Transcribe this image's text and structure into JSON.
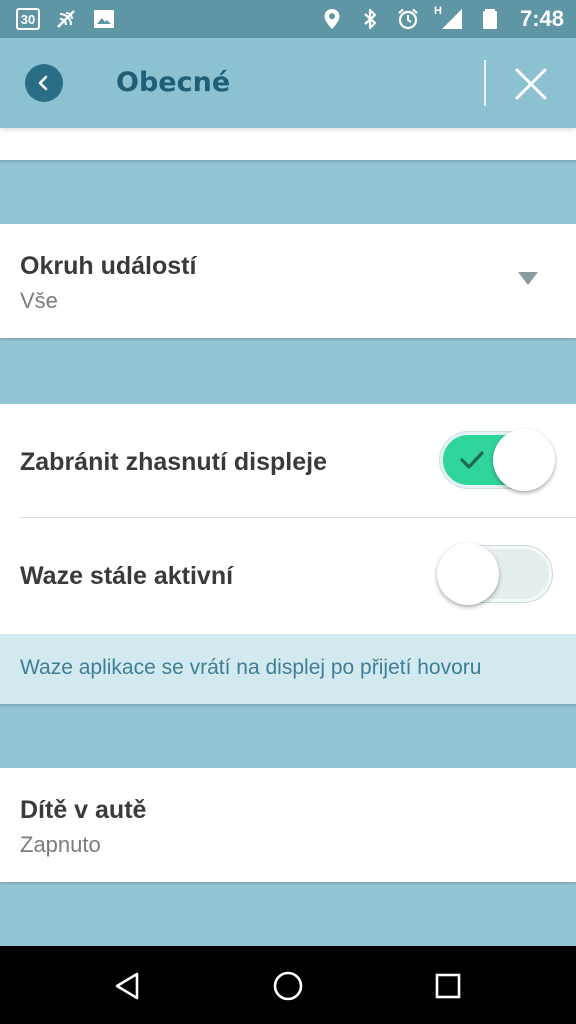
{
  "status_bar": {
    "calendar_day": "30",
    "time": "7:48",
    "network_type": "H",
    "icons": [
      "calendar-icon",
      "nfc-icon",
      "image-icon",
      "location-icon",
      "bluetooth-icon",
      "alarm-icon",
      "signal-icon",
      "battery-icon"
    ]
  },
  "app_bar": {
    "title": "Obecné",
    "back_icon": "chevron-left-icon",
    "close_icon": "close-icon"
  },
  "settings": {
    "event_scope": {
      "title": "Okruh událostí",
      "value": "Vše"
    },
    "prevent_screen_off": {
      "title": "Zabránit zhasnutí displeje",
      "checked": true
    },
    "waze_always_active": {
      "title": "Waze stále aktivní",
      "checked": false,
      "info": "Waze aplikace se vrátí na displej po přijetí hovoru"
    },
    "child_in_car": {
      "title": "Dítě v autě",
      "value": "Zapnuto"
    }
  },
  "colors": {
    "status_bar": "#5e96a6",
    "app_bar": "#8cc1d2",
    "background": "#93c5d4",
    "accent_dark": "#2a6e86",
    "toggle_on": "#2fd59a",
    "info_banner": "#d2e9ef",
    "info_text": "#3f7f96"
  },
  "nav_bar": {
    "icons": [
      "nav-back-icon",
      "nav-home-icon",
      "nav-recent-icon"
    ]
  }
}
